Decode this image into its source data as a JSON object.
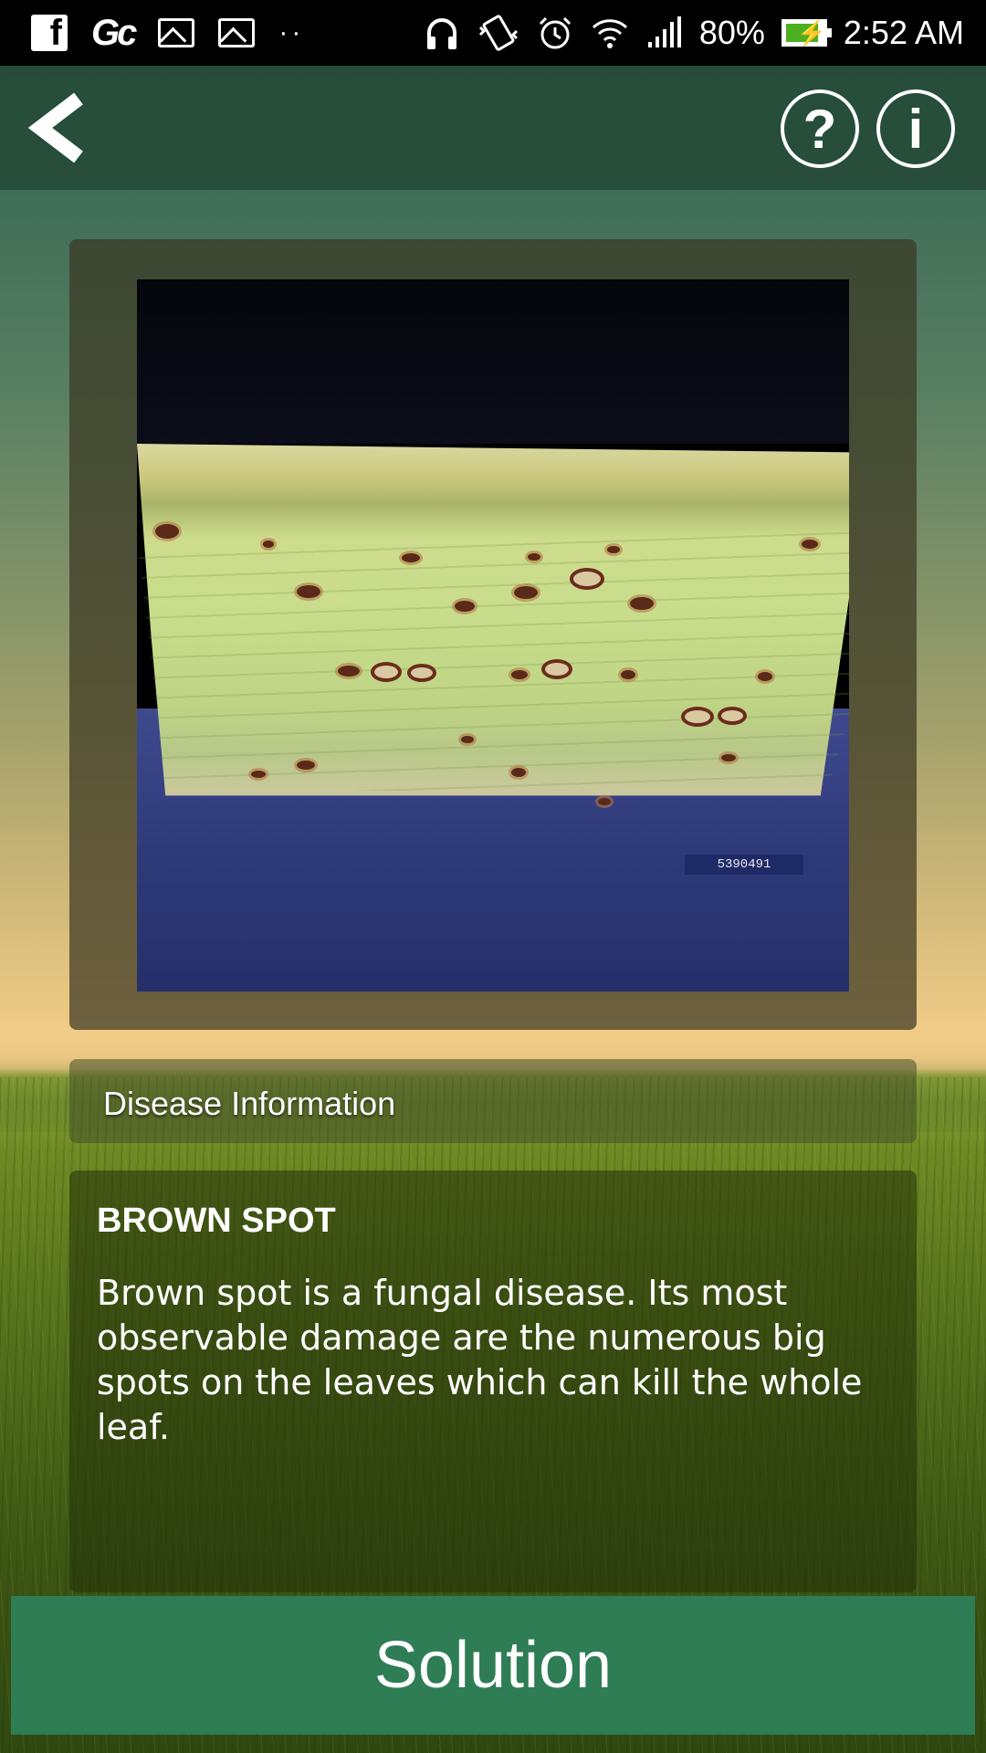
{
  "status_bar": {
    "battery_percent": "80%",
    "time": "2:52 AM",
    "battery_level": 0.8,
    "icons": [
      "facebook-icon",
      "gc-icon",
      "image-icon",
      "image-icon",
      "more-dots-icon",
      "headphones-icon",
      "vibrate-icon",
      "alarm-icon",
      "wifi-icon",
      "signal-icon",
      "battery-charging-icon"
    ]
  },
  "app_bar": {
    "back_icon": "chevron-left-icon",
    "help_label": "?",
    "info_label": "i"
  },
  "photo": {
    "stamp_text": "5390491"
  },
  "section": {
    "header": "Disease Information"
  },
  "disease": {
    "name": "BROWN SPOT",
    "description": "Brown spot is a fungal disease. Its most observable damage are the numerous big spots on the leaves which can kill the whole leaf."
  },
  "actions": {
    "solution_label": "Solution"
  },
  "colors": {
    "app_bar": "#264b3a",
    "solution_button": "#2e7d55",
    "text": "#ffffff"
  }
}
